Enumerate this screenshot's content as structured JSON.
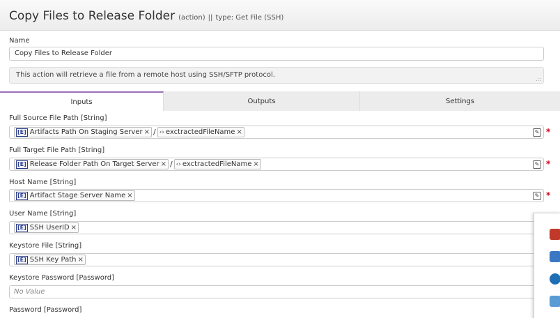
{
  "header": {
    "title": "Copy Files to Release Folder",
    "subtitle": "(action)",
    "separator": "||",
    "type_info": "type: Get File (SSH)"
  },
  "name_label": "Name",
  "name_value": "Copy Files to Release Folder",
  "description": "This action will retrieve a file from a remote host using SSH/SFTP protocol.",
  "tabs": [
    {
      "label": "Inputs"
    },
    {
      "label": "Outputs"
    },
    {
      "label": "Settings"
    }
  ],
  "fields": {
    "source": {
      "label": "Full Source File Path [String]",
      "token1": "Artifacts Path On Staging Server",
      "separator": "/",
      "token2": "exctractedFileName"
    },
    "target": {
      "label": "Full Target File Path [String]",
      "token1": "Release Folder Path On Target Server",
      "separator": "/",
      "token2": "exctractedFileName"
    },
    "host": {
      "label": "Host Name [String]",
      "token1": "Artifact Stage Server Name"
    },
    "user": {
      "label": "User Name [String]",
      "token1": "SSH UserID"
    },
    "keystore": {
      "label": "Keystore File [String]",
      "token1": "SSH Key Path"
    },
    "keystore_password": {
      "label": "Keystore Password [Password]",
      "placeholder": "No Value"
    },
    "password": {
      "label": "Password [Password]"
    }
  },
  "icons": {
    "token_variable": "[E]",
    "token_code": "‹›",
    "remove": "×",
    "edit": "✎",
    "required": "*",
    "resize_grip": ".::"
  },
  "colors": {
    "active_tab_accent": "#9b6fb6",
    "required": "#d0021b",
    "token_icon": "#2c3e8c"
  }
}
